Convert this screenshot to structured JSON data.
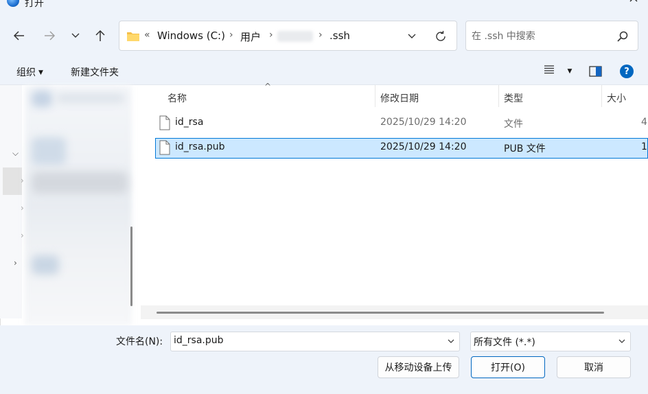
{
  "window": {
    "title": "打开"
  },
  "nav": {
    "breadcrumbs": [
      "Windows (C:)",
      "用户",
      ".ssh"
    ],
    "overflow_glyph": "«",
    "separator": "›"
  },
  "search": {
    "placeholder": "在 .ssh 中搜索"
  },
  "toolbar": {
    "organize_label": "组织",
    "new_folder_label": "新建文件夹"
  },
  "file_list": {
    "columns": [
      "名称",
      "修改日期",
      "类型",
      "大小"
    ],
    "rows": [
      {
        "name": "id_rsa",
        "modified": "2025/10/29 14:20",
        "type": "文件",
        "size": "4",
        "selected": false
      },
      {
        "name": "id_rsa.pub",
        "modified": "2025/10/29 14:20",
        "type": "PUB 文件",
        "size": "1",
        "selected": true
      }
    ]
  },
  "footer": {
    "filename_label": "文件名(N):",
    "filename_value": "id_rsa.pub",
    "filetype_value": "所有文件 (*.*)",
    "upload_button": "从移动设备上传",
    "open_button": "打开(O)",
    "cancel_button": "取消"
  },
  "colors": {
    "chrome_bg": "#eef3fa",
    "selection_bg": "#cce8ff",
    "selection_border": "#0078d7",
    "help_blue": "#0067c0",
    "folder_yellow": "#f5c04a"
  }
}
